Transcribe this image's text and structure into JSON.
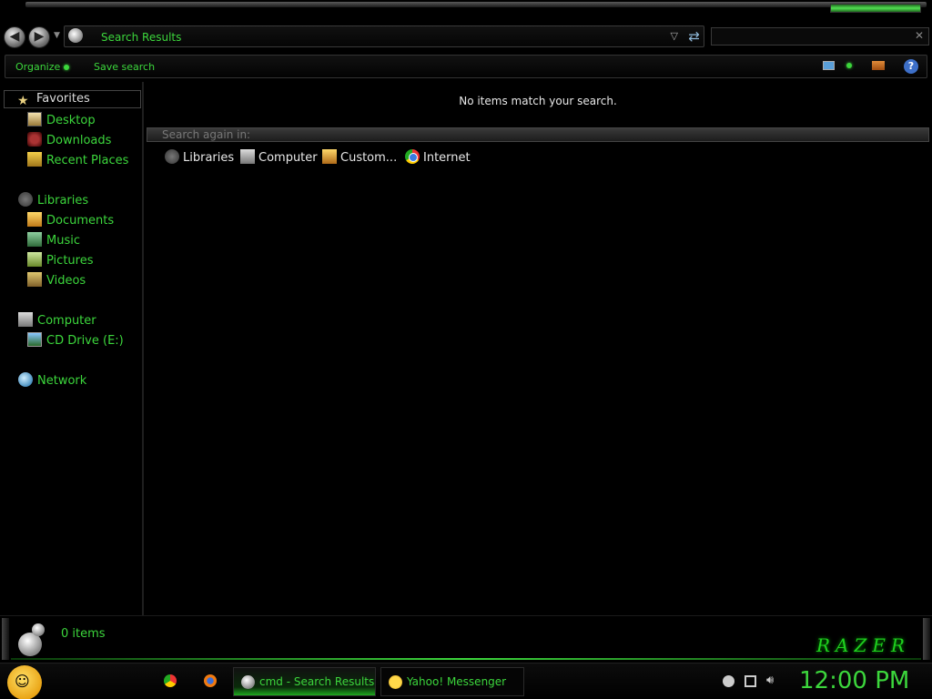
{
  "window": {
    "address": "Search Results",
    "search_placeholder": ""
  },
  "toolbar": {
    "organize_label": "Organize",
    "save_search_label": "Save search",
    "help_label": "?"
  },
  "sidebar": {
    "favorites_label": "Favorites",
    "favorites": [
      "Desktop",
      "Downloads",
      "Recent Places"
    ],
    "libraries_label": "Libraries",
    "libraries": [
      "Documents",
      "Music",
      "Pictures",
      "Videos"
    ],
    "computer_label": "Computer",
    "computer": [
      "CD Drive (E:)"
    ],
    "network_label": "Network"
  },
  "main": {
    "empty_message": "No items match your search.",
    "search_again_label": "Search again in:",
    "locations": [
      "Libraries",
      "Computer",
      "Custom...",
      "Internet"
    ]
  },
  "details": {
    "item_count": "0 items",
    "brand_logo_text": "RAZER"
  },
  "taskbar": {
    "tasks": [
      "cmd - Search Results",
      "Yahoo! Messenger"
    ],
    "clock": "12:00 PM"
  },
  "colors": {
    "accent": "#3cd63c",
    "background": "#000000"
  }
}
